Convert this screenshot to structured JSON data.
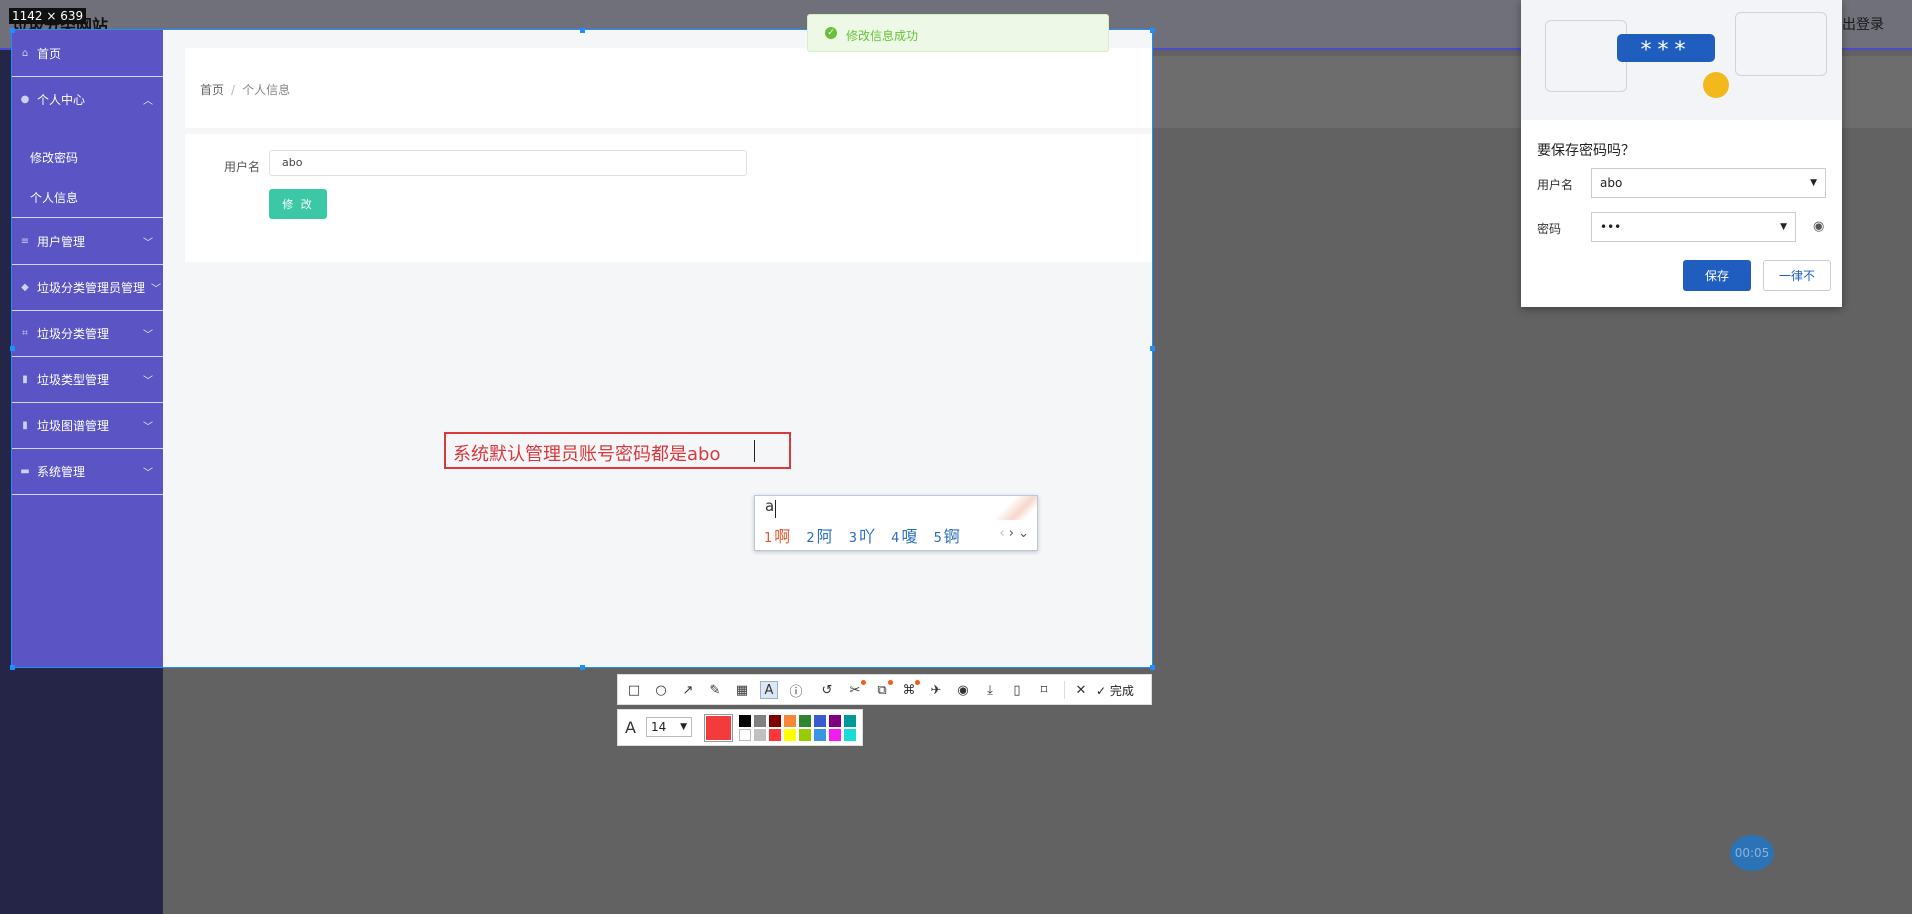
{
  "app": {
    "title": "垃圾分类网站",
    "logout": "退出登录"
  },
  "screenshot_badge": "1142 × 639",
  "toast": "修改信息成功",
  "sidebar": {
    "items": [
      {
        "label": "首页",
        "icon": "home-icon"
      },
      {
        "label": "个人中心",
        "icon": "user-icon",
        "expanded": true
      },
      {
        "label": "用户管理",
        "icon": "list-icon"
      },
      {
        "label": "垃圾分类管理员管理",
        "icon": "shield-icon"
      },
      {
        "label": "垃圾分类管理",
        "icon": "crop-icon"
      },
      {
        "label": "垃圾类型管理",
        "icon": "trash-icon"
      },
      {
        "label": "垃圾图谱管理",
        "icon": "trash-icon"
      },
      {
        "label": "系统管理",
        "icon": "monitor-icon"
      }
    ],
    "sub_items": [
      "修改密码",
      "个人信息"
    ]
  },
  "breadcrumb": {
    "home": "首页",
    "current": "个人信息"
  },
  "form": {
    "username_label": "用户名",
    "username_value": "abo",
    "submit_label": "修 改"
  },
  "annotation": {
    "text": "系统默认管理员账号密码都是abo"
  },
  "ime": {
    "input": "a",
    "candidates": [
      {
        "n": "1",
        "c": "啊"
      },
      {
        "n": "2",
        "c": "阿"
      },
      {
        "n": "3",
        "c": "吖"
      },
      {
        "n": "4",
        "c": "嗄"
      },
      {
        "n": "5",
        "c": "锕"
      }
    ]
  },
  "toolbar": {
    "done_label": "完成",
    "font_size": "14",
    "current_color": "#f33b3b",
    "swatches_top": [
      "#000000",
      "#808080",
      "#800000",
      "#f7883a",
      "#308430",
      "#385ad3",
      "#800080",
      "#009999"
    ],
    "swatches_bottom": [
      "#ffffff",
      "#c0c0c0",
      "#fb3838",
      "#ffff00",
      "#99cc00",
      "#3894e4",
      "#f31bf3",
      "#16dcdc"
    ]
  },
  "password_dialog": {
    "title": "要保存密码吗？",
    "username_label": "用户名",
    "username_value": "abo",
    "password_label": "密码",
    "password_value": "•••",
    "save_label": "保存",
    "never_label": "一律不",
    "stars": "***"
  },
  "timer": "00:05"
}
